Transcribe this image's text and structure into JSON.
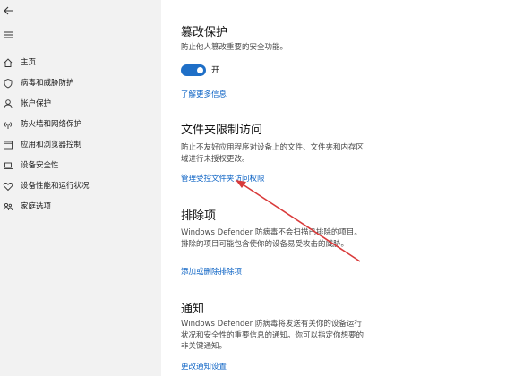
{
  "nav": {
    "back_icon": "back-arrow-icon",
    "menu_icon": "hamburger-menu-icon",
    "items": [
      {
        "label": "主页",
        "icon": "home-icon"
      },
      {
        "label": "病毒和威胁防护",
        "icon": "shield-icon"
      },
      {
        "label": "帐户保护",
        "icon": "person-icon"
      },
      {
        "label": "防火墙和网络保护",
        "icon": "wifi-signal-icon"
      },
      {
        "label": "应用和浏览器控制",
        "icon": "browser-window-icon"
      },
      {
        "label": "设备安全性",
        "icon": "laptop-icon"
      },
      {
        "label": "设备性能和运行状况",
        "icon": "heart-icon"
      },
      {
        "label": "家庭选项",
        "icon": "family-icon"
      }
    ]
  },
  "tamper": {
    "title": "篡改保护",
    "desc": "防止他人篡改重要的安全功能。",
    "toggle_state": "开",
    "toggle_on": true,
    "link": "了解更多信息"
  },
  "folder_access": {
    "title": "文件夹限制访问",
    "desc": "防止不友好应用程序对设备上的文件、文件夹和内存区域进行未授权更改。",
    "link": "管理受控文件夹访问权限"
  },
  "exclusions": {
    "title": "排除项",
    "desc": "Windows Defender 防病毒不会扫描已排除的项目。排除的项目可能包含使你的设备易受攻击的威胁。",
    "link": "添加或删除排除项"
  },
  "notifications": {
    "title": "通知",
    "desc": "Windows Defender 防病毒将发送有关你的设备运行状况和安全性的重要信息的通知。你可以指定你想要的非关键通知。",
    "link": "更改通知设置"
  },
  "colors": {
    "accent": "#1f6fc7",
    "link": "#0b62c4",
    "sidebar_bg": "#f2f2f2",
    "annotation_arrow": "#d93a3a"
  }
}
